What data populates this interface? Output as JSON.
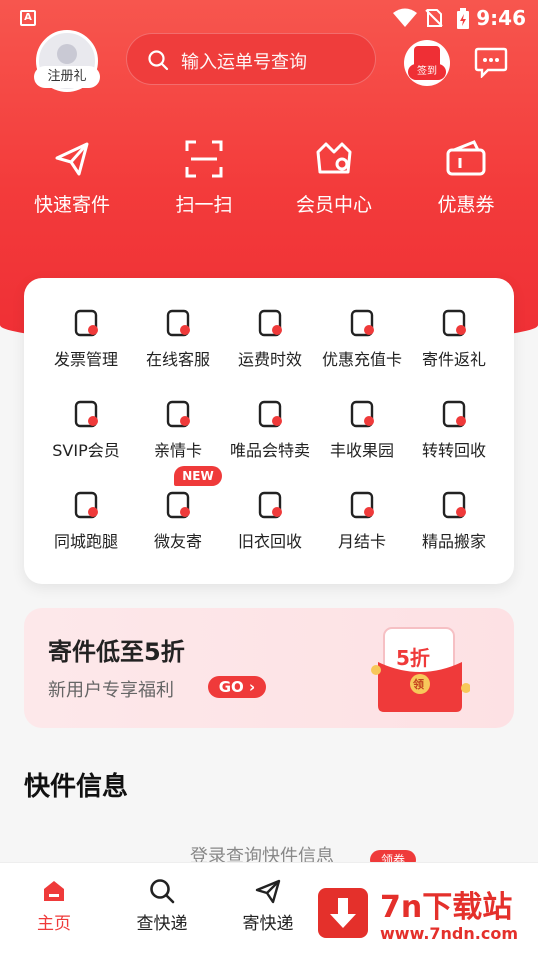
{
  "status_bar": {
    "time": "9:46",
    "app_badge": "A"
  },
  "header": {
    "register_gift": "注册礼",
    "search_placeholder": "输入运单号查询",
    "signin_label": "签到"
  },
  "quick_actions": [
    {
      "label": "快速寄件",
      "icon": "send-plane-icon"
    },
    {
      "label": "扫一扫",
      "icon": "scan-icon"
    },
    {
      "label": "会员中心",
      "icon": "member-crown-icon"
    },
    {
      "label": "优惠券",
      "icon": "coupon-icon"
    }
  ],
  "services": [
    {
      "label": "发票管理",
      "icon": "invoice-icon"
    },
    {
      "label": "在线客服",
      "icon": "headset-icon"
    },
    {
      "label": "运费时效",
      "icon": "stopwatch-icon"
    },
    {
      "label": "优惠充值卡",
      "icon": "recharge-card-icon"
    },
    {
      "label": "寄件返礼",
      "icon": "wallet-gift-icon"
    },
    {
      "label": "SVIP会员",
      "icon": "svip-badge-icon"
    },
    {
      "label": "亲情卡",
      "icon": "heart-card-icon"
    },
    {
      "label": "唯品会特卖",
      "icon": "shopping-bag-icon"
    },
    {
      "label": "丰收果园",
      "icon": "fruit-icon"
    },
    {
      "label": "转转回收",
      "icon": "bear-recycle-icon"
    },
    {
      "label": "同城跑腿",
      "icon": "location-pin-icon"
    },
    {
      "label": "微友寄",
      "icon": "wechat-friend-send-icon"
    },
    {
      "label": "旧衣回收",
      "icon": "tshirt-icon"
    },
    {
      "label": "月结卡",
      "icon": "calendar-icon"
    },
    {
      "label": "精品搬家",
      "icon": "moving-truck-icon"
    }
  ],
  "new_badge": "NEW",
  "promo": {
    "title": "寄件低至5折",
    "subtitle": "新用户专享福利",
    "go_label": "GO",
    "envelope_discount": "5折",
    "envelope_claim": "领"
  },
  "section_title": "快件信息",
  "login_tip": "登录查询快件信息",
  "coupon_tag": "领券",
  "tabs": [
    {
      "label": "主页",
      "icon": "home-icon",
      "active": true
    },
    {
      "label": "查快递",
      "icon": "search-icon",
      "active": false
    },
    {
      "label": "寄快递",
      "icon": "send-icon",
      "active": false
    }
  ],
  "watermark": {
    "brand": "7n下载站",
    "url": "www.7ndn.com"
  },
  "colors": {
    "brand_red": "#ef3a3a",
    "hero_red": "#f33b3b"
  }
}
